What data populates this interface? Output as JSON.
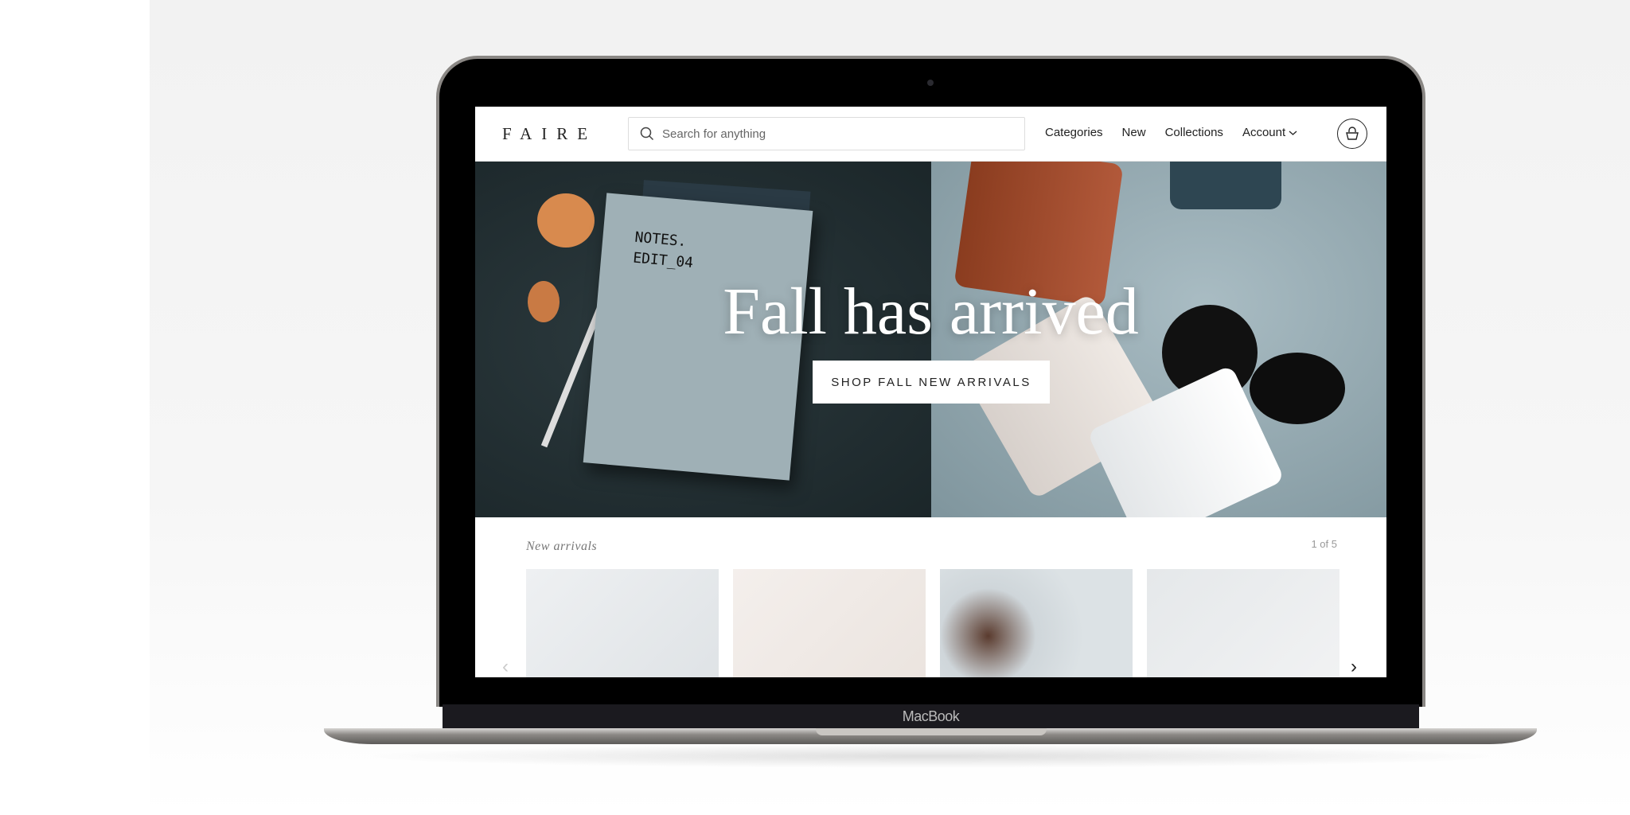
{
  "device": {
    "brand_label": "MacBook"
  },
  "nav": {
    "logo": "FAIRE",
    "search_placeholder": "Search for anything",
    "links": [
      "Categories",
      "New",
      "Collections",
      "Account"
    ]
  },
  "hero": {
    "title": "Fall has arrived",
    "cta": "SHOP FALL NEW ARRIVALS",
    "book_text": "NOTES.\nEDIT_04"
  },
  "new_arrivals": {
    "title": "New arrivals",
    "pagination": "1 of 5"
  },
  "icons": {
    "search": "search-icon",
    "account_chevron": "chevron-down-icon",
    "bag": "shopping-bag-icon",
    "prev": "chevron-left-icon",
    "next": "chevron-right-icon"
  }
}
